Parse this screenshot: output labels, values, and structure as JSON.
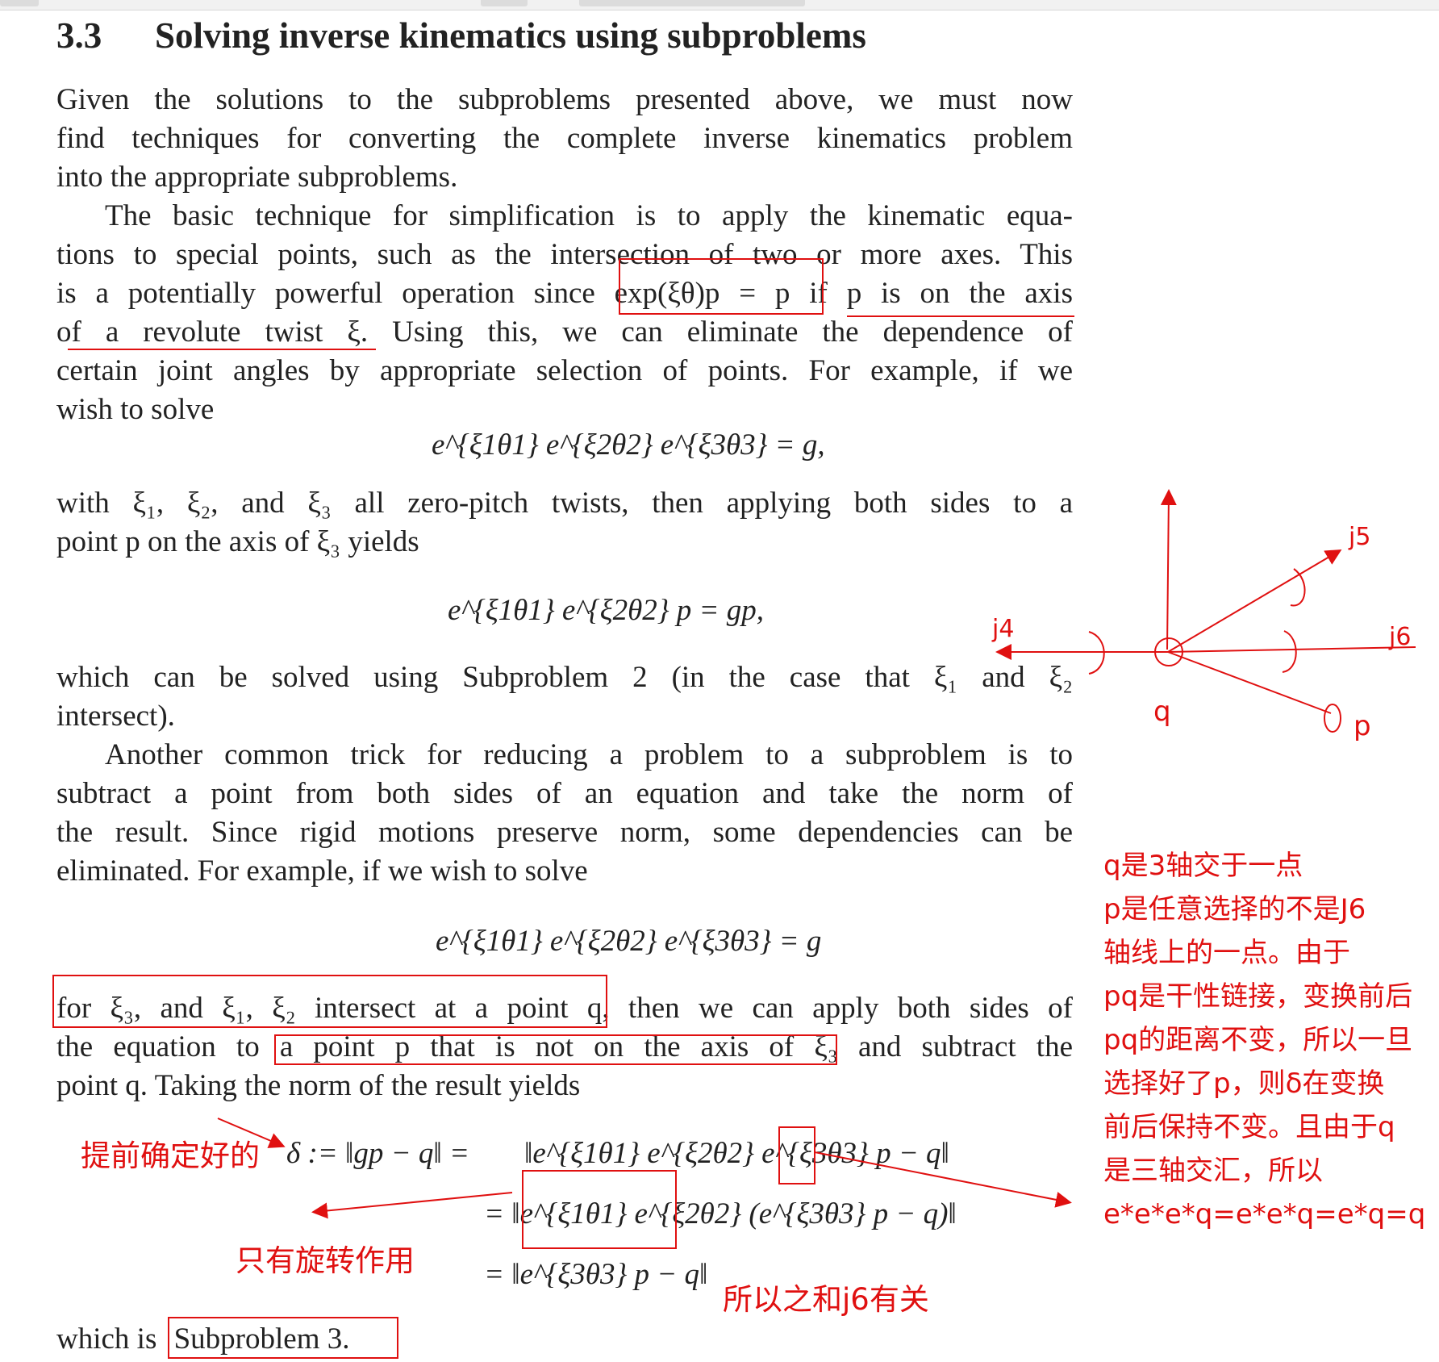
{
  "section": {
    "number": "3.3",
    "title": "Solving inverse kinematics using subproblems"
  },
  "para1": [
    "Given the solutions to the subproblems presented above, we must now",
    "find techniques for converting the complete inverse kinematics problem",
    "into the appropriate subproblems."
  ],
  "para2": [
    "The basic technique for simplification is to apply the kinematic equa-",
    "tions to special points, such as the intersection of two or more axes. This",
    "is a potentially powerful operation since exp(ξθ)p = p if p is on the axis",
    "of a revolute twist ξ.  Using this, we can eliminate the dependence of",
    "certain joint angles by appropriate selection of points. For example, if we",
    "wish to solve"
  ],
  "eq1": "e^{ξ1θ1} e^{ξ2θ2} e^{ξ3θ3} = g,",
  "para3": [
    "with ξ₁, ξ₂, and ξ₃ all zero-pitch twists, then applying both sides to a",
    "point p on the axis of ξ₃ yields"
  ],
  "eq2": "e^{ξ1θ1} e^{ξ2θ2} p = gp,",
  "para4": [
    "which can be solved using Subproblem 2 (in the case that ξ₁ and ξ₂",
    "intersect)."
  ],
  "para5": [
    "Another common trick for reducing a problem to a subproblem is to",
    "subtract a point from both sides of an equation and take the norm of",
    "the result. Since rigid motions preserve norm, some dependencies can be",
    "eliminated. For example, if we wish to solve"
  ],
  "eq3": "e^{ξ1θ1} e^{ξ2θ2} e^{ξ3θ3} = g",
  "para6": [
    "for ξ₃, and ξ₁, ξ₂ intersect at a point q, then we can apply both sides of",
    "the equation to a point p that is not on the axis of ξ₃ and subtract the",
    "point q. Taking the norm of the result yields"
  ],
  "eq4": {
    "lhs": "δ := ‖gp − q‖ =",
    "r1": "‖e^{ξ1θ1} e^{ξ2θ2} e^{ξ3θ3} p − q‖",
    "r2": "= ‖e^{ξ1θ1} e^{ξ2θ2} (e^{ξ3θ3} p − q)‖",
    "r3": "= ‖e^{ξ3θ3} p − q‖"
  },
  "para7": {
    "pre": "which is",
    "box": "Subproblem 3."
  },
  "annotations": {
    "predetermined": "提前确定好的",
    "rotation_only": "只有旋转作用",
    "only_j6": "所以之和j6有关",
    "diagram": {
      "j4": "j4",
      "j5": "j5",
      "j6": "j6",
      "q": "q",
      "p": "p"
    },
    "note": [
      "q是3轴交于一点",
      "p是任意选择的不是J6",
      "轴线上的一点。由于",
      "pq是干性链接，变换前后",
      "pq的距离不变，所以一旦",
      "选择好了p，则δ在变换",
      "前后保持不变。且由于q",
      "是三轴交汇，所以",
      "e*e*e*q=e*e*q=e*q=q"
    ]
  },
  "colors": {
    "annotation": "#e01010",
    "text": "#222222"
  }
}
